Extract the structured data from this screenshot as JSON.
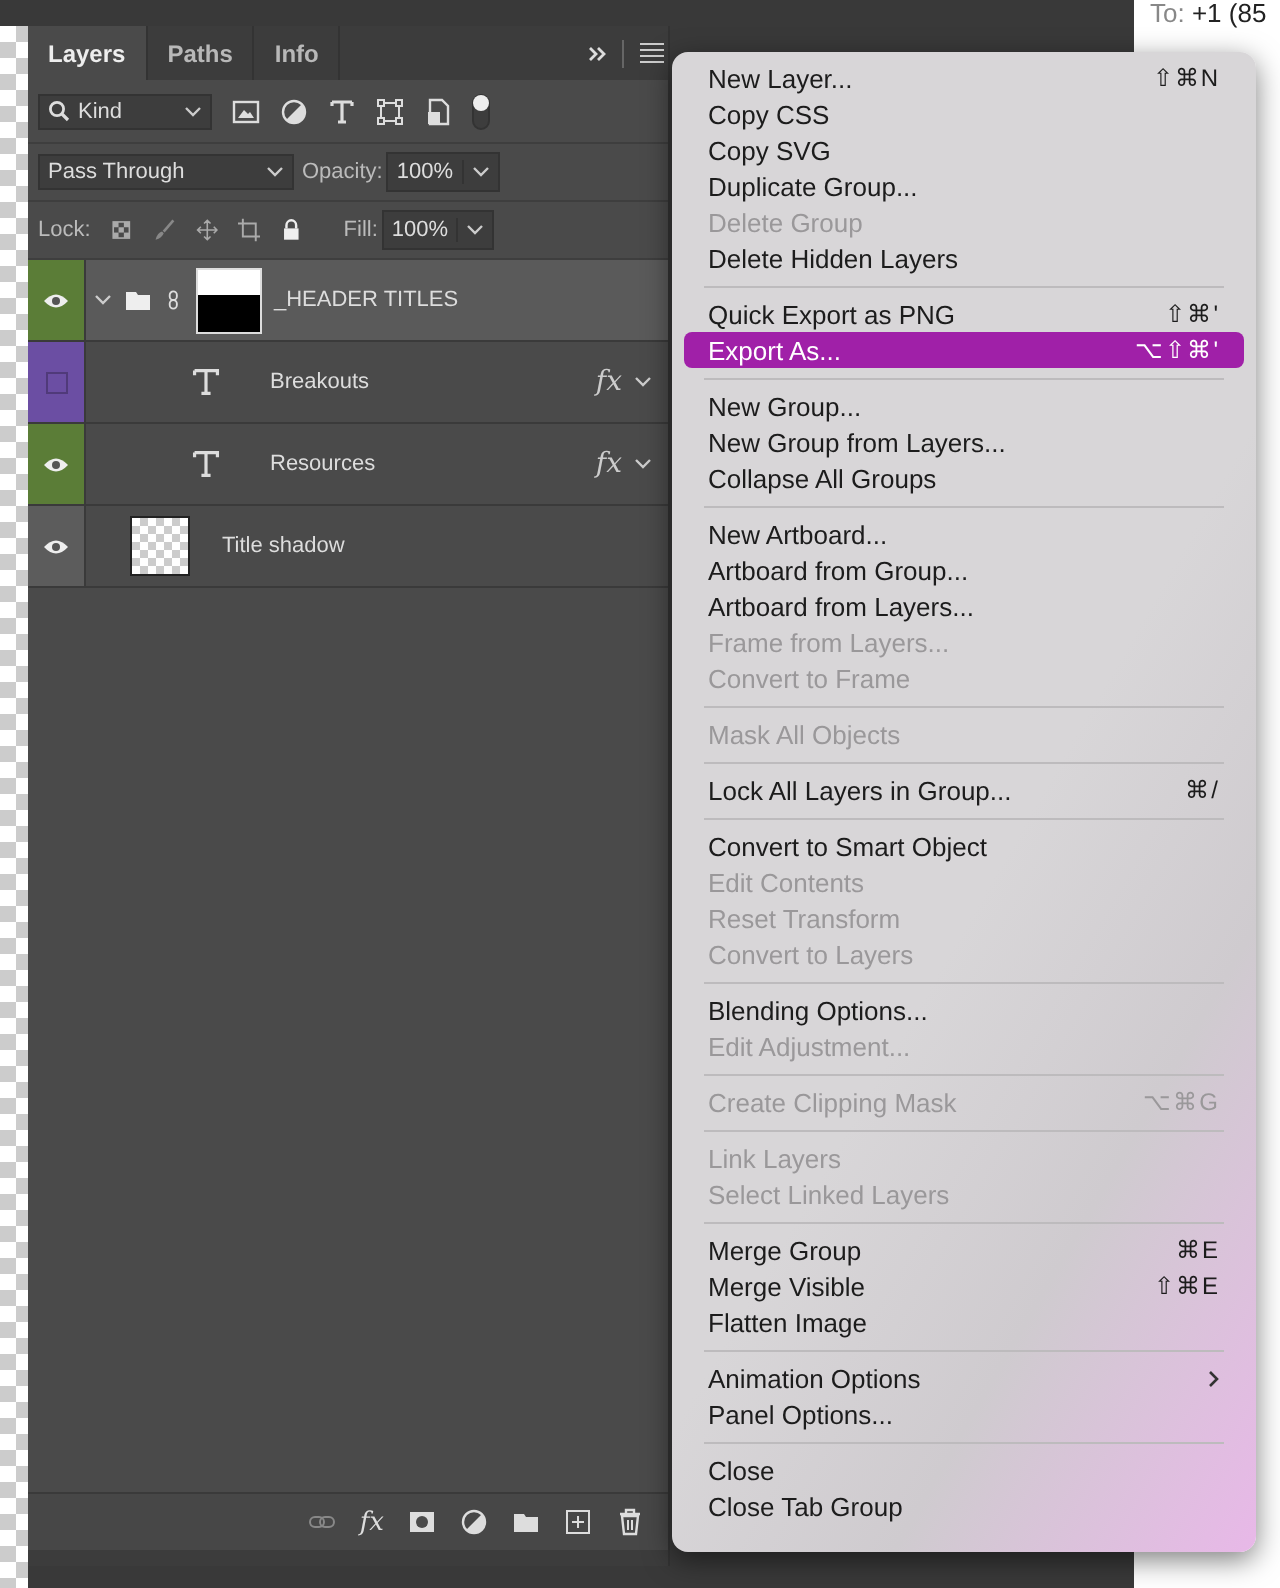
{
  "backdrop": {
    "recipient": {
      "label": "To:",
      "value": "+1 (85"
    }
  },
  "panel": {
    "tabs": [
      {
        "label": "Layers",
        "selected": true
      },
      {
        "label": "Paths",
        "selected": false
      },
      {
        "label": "Info",
        "selected": false
      }
    ],
    "filter": {
      "value": "Kind"
    },
    "blend_mode": {
      "value": "Pass Through"
    },
    "opacity": {
      "label": "Opacity:",
      "value": "100%"
    },
    "lock": {
      "label": "Lock:"
    },
    "fill": {
      "label": "Fill:",
      "value": "100%"
    },
    "layers": [
      {
        "name": "_HEADER TITLES",
        "kind": "group",
        "visible": true,
        "selected": true,
        "color": "#5b7d37",
        "expanded": true,
        "children": [
          {
            "name": "Breakouts",
            "kind": "text",
            "visible": false,
            "selected": false,
            "color": "#6b4ea3",
            "effects": "fx"
          },
          {
            "name": "Resources",
            "kind": "text",
            "visible": true,
            "selected": false,
            "color": "#5b7d37",
            "effects": "fx"
          }
        ]
      },
      {
        "name": "Title shadow",
        "kind": "image",
        "visible": true,
        "selected": false
      }
    ],
    "footer": {
      "style_button": "fx"
    }
  },
  "menu": {
    "sections": [
      {
        "items": [
          {
            "label": "New Layer...",
            "shortcut": "⇧⌘N",
            "disabled": false,
            "selected": false
          },
          {
            "label": "Copy CSS",
            "disabled": false,
            "selected": false
          },
          {
            "label": "Copy SVG",
            "disabled": false,
            "selected": false
          },
          {
            "label": "Duplicate Group...",
            "disabled": false,
            "selected": false
          },
          {
            "label": "Delete Group",
            "disabled": true,
            "selected": false
          },
          {
            "label": "Delete Hidden Layers",
            "disabled": false,
            "selected": false
          }
        ]
      },
      {
        "items": [
          {
            "label": "Quick Export as PNG",
            "shortcut": "⇧⌘'",
            "disabled": false,
            "selected": false
          },
          {
            "label": "Export As...",
            "shortcut": "⌥⇧⌘'",
            "disabled": false,
            "selected": true
          }
        ]
      },
      {
        "items": [
          {
            "label": "New Group...",
            "disabled": false,
            "selected": false
          },
          {
            "label": "New Group from Layers...",
            "disabled": false,
            "selected": false
          },
          {
            "label": "Collapse All Groups",
            "disabled": false,
            "selected": false
          }
        ]
      },
      {
        "items": [
          {
            "label": "New Artboard...",
            "disabled": false,
            "selected": false
          },
          {
            "label": "Artboard from Group...",
            "disabled": false,
            "selected": false
          },
          {
            "label": "Artboard from Layers...",
            "disabled": false,
            "selected": false
          },
          {
            "label": "Frame from Layers...",
            "disabled": true,
            "selected": false
          },
          {
            "label": "Convert to Frame",
            "disabled": true,
            "selected": false
          }
        ]
      },
      {
        "items": [
          {
            "label": "Mask All Objects",
            "disabled": true,
            "selected": false
          }
        ]
      },
      {
        "items": [
          {
            "label": "Lock All Layers in Group...",
            "shortcut": "⌘/",
            "disabled": false,
            "selected": false
          }
        ]
      },
      {
        "items": [
          {
            "label": "Convert to Smart Object",
            "disabled": false,
            "selected": false
          },
          {
            "label": "Edit Contents",
            "disabled": true,
            "selected": false
          },
          {
            "label": "Reset Transform",
            "disabled": true,
            "selected": false
          },
          {
            "label": "Convert to Layers",
            "disabled": true,
            "selected": false
          }
        ]
      },
      {
        "items": [
          {
            "label": "Blending Options...",
            "disabled": false,
            "selected": false
          },
          {
            "label": "Edit Adjustment...",
            "disabled": true,
            "selected": false
          }
        ]
      },
      {
        "items": [
          {
            "label": "Create Clipping Mask",
            "shortcut": "⌥⌘G",
            "disabled": true,
            "selected": false
          }
        ]
      },
      {
        "items": [
          {
            "label": "Link Layers",
            "disabled": true,
            "selected": false
          },
          {
            "label": "Select Linked Layers",
            "disabled": true,
            "selected": false
          }
        ]
      },
      {
        "items": [
          {
            "label": "Merge Group",
            "shortcut": "⌘E",
            "disabled": false,
            "selected": false
          },
          {
            "label": "Merge Visible",
            "shortcut": "⇧⌘E",
            "disabled": false,
            "selected": false
          },
          {
            "label": "Flatten Image",
            "disabled": false,
            "selected": false
          }
        ]
      },
      {
        "items": [
          {
            "label": "Animation Options",
            "disabled": false,
            "selected": false,
            "submenu": true
          },
          {
            "label": "Panel Options...",
            "disabled": false,
            "selected": false
          }
        ]
      },
      {
        "items": [
          {
            "label": "Close",
            "disabled": false,
            "selected": false
          },
          {
            "label": "Close Tab Group",
            "disabled": false,
            "selected": false
          }
        ]
      }
    ]
  }
}
